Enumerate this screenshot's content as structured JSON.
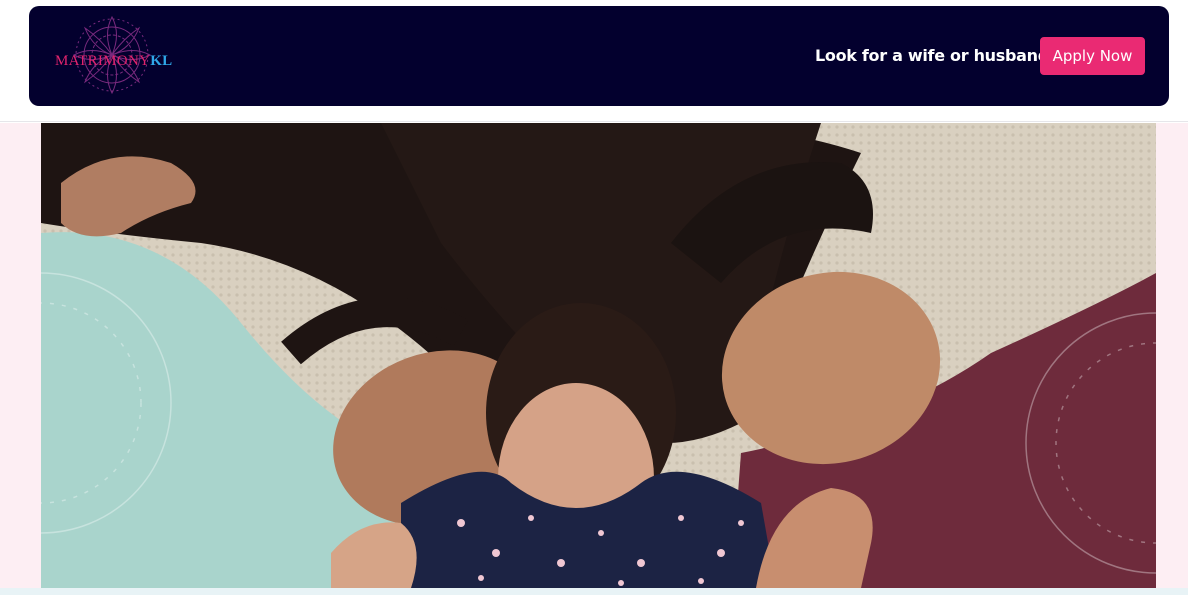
{
  "header": {
    "logo": {
      "brand_main": "MATRIMONY",
      "brand_accent": "KL",
      "icon": "mandala-icon"
    },
    "question": "Look for a wife or husband?",
    "apply_label": "Apply Now"
  },
  "hero": {
    "image": "family-photo"
  },
  "colors": {
    "navbar": "#03002e",
    "accent": "#ea2a73",
    "logo_accent": "#2fa7e8",
    "page_tint": "#fdeef3"
  }
}
